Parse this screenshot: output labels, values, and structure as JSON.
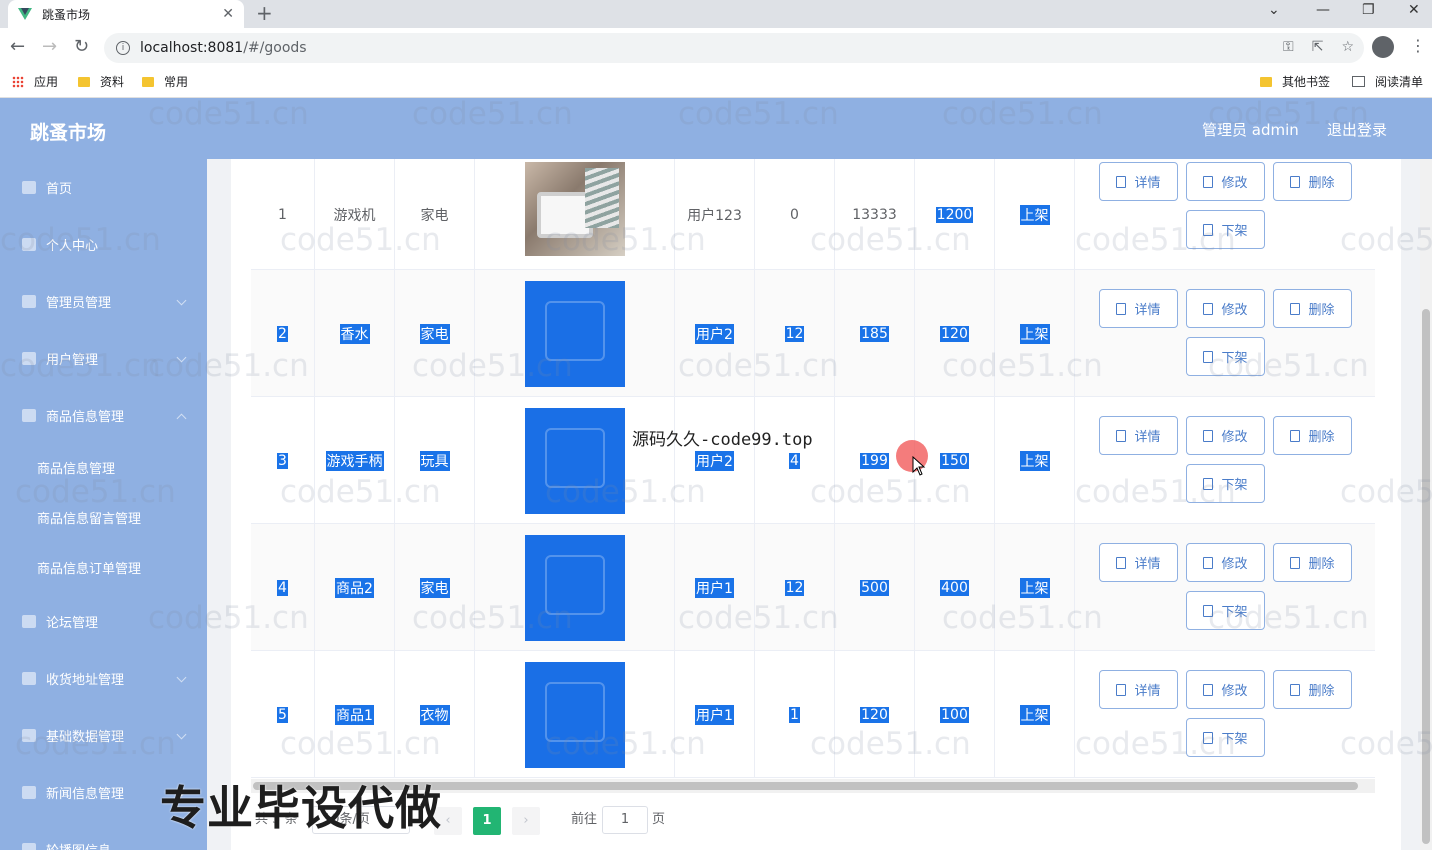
{
  "browser": {
    "tab_title": "跳蚤市场",
    "url_host": "localhost:8081",
    "url_path": "/#/goods",
    "bookmarks": [
      "应用",
      "资料",
      "常用"
    ],
    "bookmarks_right": [
      "其他书签",
      "阅读清单"
    ]
  },
  "header": {
    "title": "跳蚤市场",
    "admin_label": "管理员 admin",
    "logout_label": "退出登录"
  },
  "sidebar": {
    "items": [
      {
        "label": "首页",
        "icon": "home-icon"
      },
      {
        "label": "个人中心",
        "icon": "user-icon"
      },
      {
        "label": "管理员管理",
        "icon": "admin-icon"
      },
      {
        "label": "用户管理",
        "icon": "list-icon"
      },
      {
        "label": "商品信息管理",
        "icon": "goods-icon"
      },
      {
        "label": "论坛管理",
        "icon": "forum-icon"
      },
      {
        "label": "收货地址管理",
        "icon": "address-icon"
      },
      {
        "label": "基础数据管理",
        "icon": "data-icon"
      },
      {
        "label": "新闻信息管理",
        "icon": "send-icon"
      },
      {
        "label": "轮播图信息",
        "icon": "image-icon"
      }
    ],
    "subitems": [
      "商品信息管理",
      "商品信息留言管理",
      "商品信息订单管理"
    ]
  },
  "table": {
    "rows": [
      {
        "id": "1",
        "name": "游戏机",
        "type": "家电",
        "user": "用户123",
        "stock": "0",
        "price": "13333",
        "new_price": "1200",
        "status": "上架",
        "selected": false
      },
      {
        "id": "2",
        "name": "香水",
        "type": "家电",
        "user": "用户2",
        "stock": "12",
        "price": "185",
        "new_price": "120",
        "status": "上架",
        "selected": true
      },
      {
        "id": "3",
        "name": "游戏手柄",
        "type": "玩具",
        "user": "用户2",
        "stock": "4",
        "price": "199",
        "new_price": "150",
        "status": "上架",
        "selected": true
      },
      {
        "id": "4",
        "name": "商品2",
        "type": "家电",
        "user": "用户1",
        "stock": "12",
        "price": "500",
        "new_price": "400",
        "status": "上架",
        "selected": true
      },
      {
        "id": "5",
        "name": "商品1",
        "type": "衣物",
        "user": "用户1",
        "stock": "1",
        "price": "120",
        "new_price": "100",
        "status": "上架",
        "selected": true
      }
    ],
    "actions": {
      "detail": "详情",
      "edit": "修改",
      "delete": "删除",
      "offshelf": "下架"
    }
  },
  "pagination": {
    "total_prefix": "共",
    "total": "5",
    "total_suffix": "条",
    "page_size": "10条/页",
    "current_page": "1",
    "goto_label": "前往",
    "goto_value": "1",
    "page_suffix": "页"
  },
  "overlays": {
    "watermark": "code51.cn",
    "code_text": "源码久久-code99.top",
    "promo_text": "专业毕设代做"
  }
}
